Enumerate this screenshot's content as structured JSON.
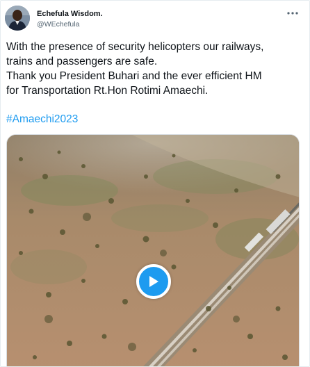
{
  "author": {
    "display_name": "Echefula Wisdom.",
    "handle": "@WEchefula"
  },
  "tweet": {
    "lines": [
      "With the presence of security helicopters our railways,",
      "trains and passengers are safe.",
      "Thank you President Buhari and the ever efficient HM",
      "for Transportation Rt.Hon Rotimi Amaechi."
    ],
    "hashtag": "#Amaechi2023"
  },
  "icons": {
    "more": "more-options-icon",
    "play": "play-icon"
  },
  "colors": {
    "text": "#0f1419",
    "secondary": "#536471",
    "accent": "#1d9bf0"
  }
}
